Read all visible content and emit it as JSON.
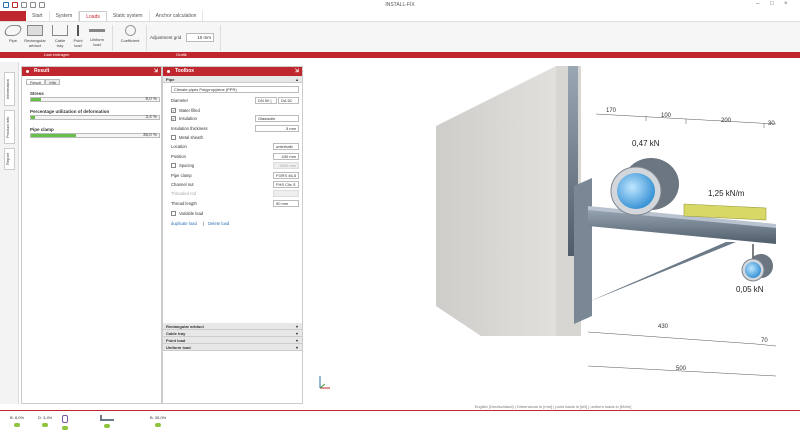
{
  "app": {
    "title": "INSTALL-FIX"
  },
  "tabs": [
    "Start",
    "System",
    "Loads",
    "Static system",
    "Anchor calculation"
  ],
  "active_tab": "Loads",
  "ribbon": {
    "buttons": [
      {
        "label": "Pipe",
        "icon": "pipe-icon"
      },
      {
        "label": "Rectangular\nartduct",
        "icon": "rectangular-duct-icon"
      },
      {
        "label": "Cable\ntray",
        "icon": "cable-tray-icon"
      },
      {
        "label": "Point\nload",
        "icon": "point-load-icon"
      },
      {
        "label": "Uniform\nload",
        "icon": "uniform-load-icon"
      },
      {
        "label": "Coefficient",
        "icon": "coefficient-icon"
      }
    ],
    "adjustment_grid_label": "Adjustment grid",
    "adjustment_grid_value": "10 mm",
    "group_labels": [
      "Last eintragen",
      "Grafik"
    ]
  },
  "vstrip": {
    "tabs": [
      "Information",
      "Product info",
      "Report"
    ]
  },
  "result_panel": {
    "title": "Result",
    "tabs": [
      "Result",
      "Info"
    ],
    "items": [
      {
        "label": "Stress",
        "value": "8,0 %",
        "fill": 0.08
      },
      {
        "label": "Percentage utilization of deformation",
        "value": "3,4 %",
        "fill": 0.034
      },
      {
        "label": "Pipe clamp",
        "value": "35,0 %",
        "fill": 0.35
      }
    ]
  },
  "toolbox": {
    "title": "Toolbox",
    "section_pipe": "Pipe",
    "material": "Climate pipes Polypropylene (PPR)",
    "diameter_label": "Diameter",
    "diameter_select1": "DN 50 |",
    "diameter_select2": "DA 5C",
    "water_filled": "Water filled",
    "insulation": "Insulation",
    "insulation_value": "Glaswolle",
    "insulation_thickness_label": "Insulation thickness",
    "insulation_thickness_value": "5 mm",
    "metal_sheath": "Metal sheath",
    "location_label": "Location",
    "location_value": "unterhalb",
    "position_label": "Position",
    "position_value": "430 mm",
    "spacing": "Spacing",
    "spacing_value": "2500 mm",
    "pipe_clamp_label": "Pipe clamp",
    "pipe_clamp_value": "FGRS 46-5",
    "channel_nut_label": "Channel nut",
    "channel_nut_value": "FHS Clic S",
    "threaded_rod_label": "Threaded rod",
    "thread_length_label": "Thread length",
    "thread_length_value": "50 mm",
    "variable_load": "Variable load",
    "duplicate_load": "duplicate load",
    "link_sep": "|",
    "delete_load": "Delete load",
    "bottom_sections": [
      "Rectangular artduct",
      "Cable tray",
      "Point load",
      "Uniform load"
    ]
  },
  "view": {
    "dims": {
      "d170": "170",
      "d100": "100",
      "d200": "200",
      "d30": "30",
      "d430": "430",
      "d70": "70",
      "d500": "500"
    },
    "load_047": "0,47 kN",
    "load_125": "1,25 kN/m",
    "load_005": "0,05 kN"
  },
  "statusbar": "English (Deutschland) | Dimensions in [mm] | point loads in [kN] | uniform loads in [kN/m]",
  "bottom_items": [
    "B: 8,0%",
    "D: 3,4%",
    "",
    "",
    "B: 35,0%"
  ]
}
